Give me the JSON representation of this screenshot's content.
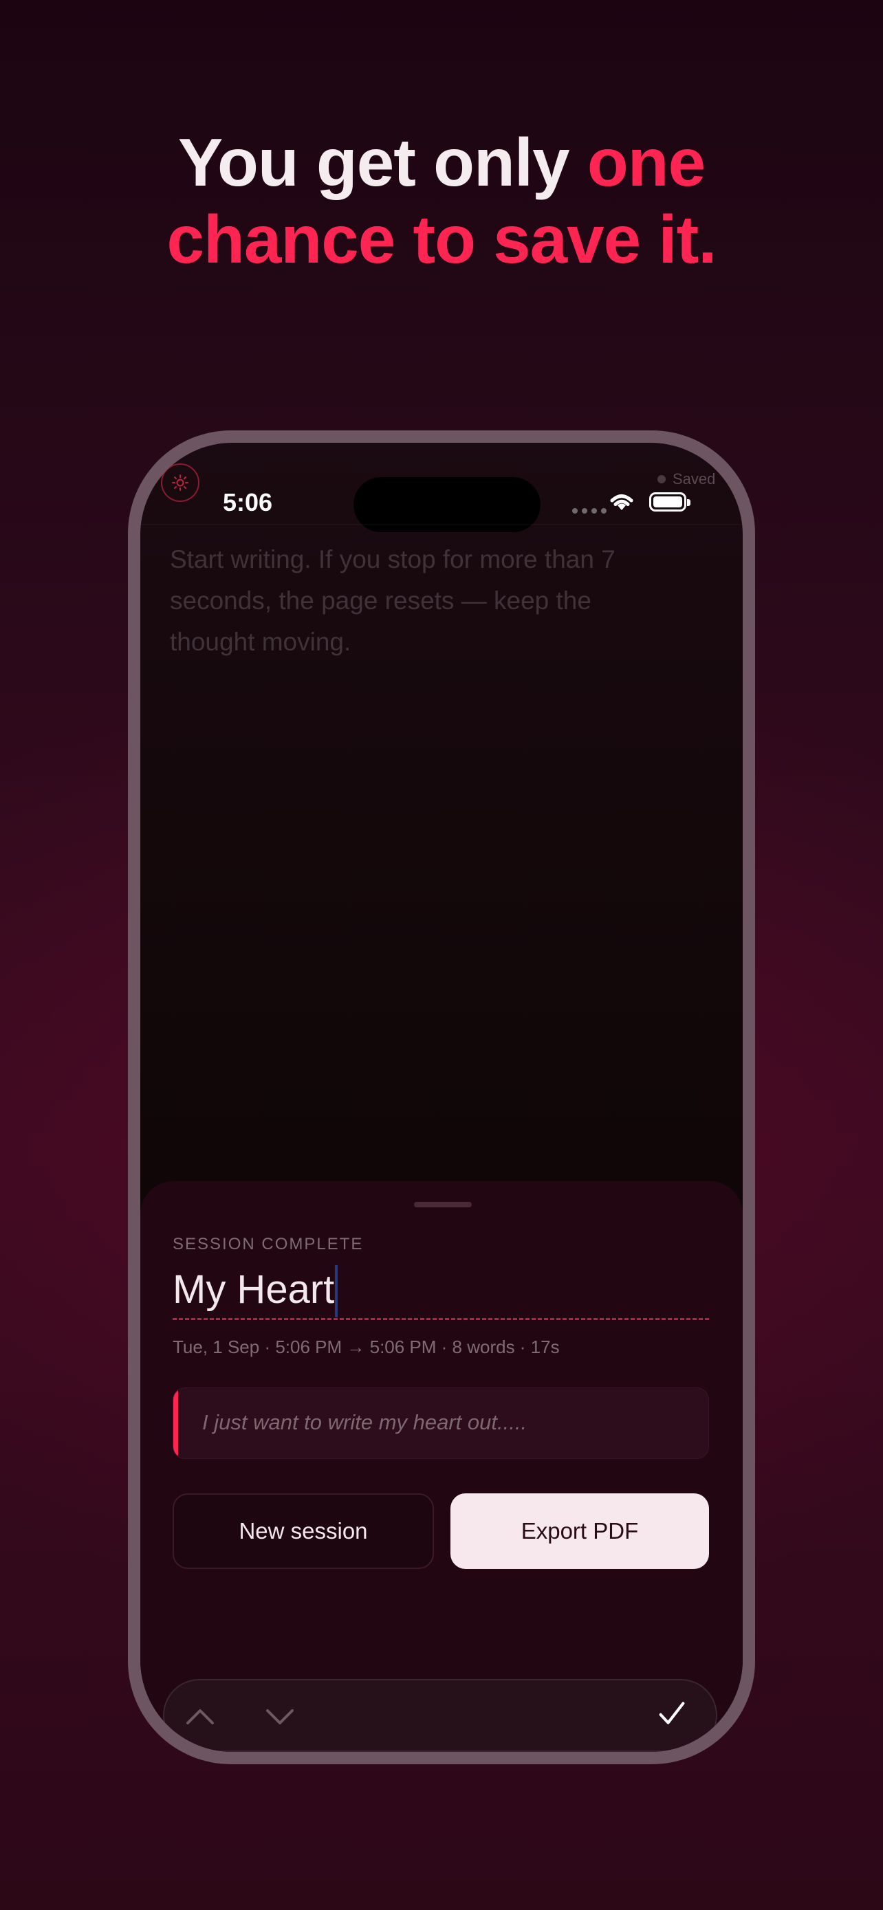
{
  "headline": {
    "line1_white": "You get only",
    "line1_red": "one",
    "line2_red": "chance to save it."
  },
  "status_bar": {
    "time": "5:06",
    "saved_label": "Saved"
  },
  "editor": {
    "prompt": "Start writing. If you stop for more than 7 seconds, the page resets — keep the thought moving."
  },
  "sheet": {
    "label": "SESSION COMPLETE",
    "title_value": "My Heart",
    "meta": "Tue, 1 Sep · 5:06 PM → 5:06 PM · 8 words · 17s",
    "excerpt": "I just want to write my heart out.....",
    "new_session_label": "New session",
    "export_label": "Export PDF"
  },
  "icons": {
    "settings": "sun-icon",
    "up": "chevron-up-icon",
    "down": "chevron-down-icon",
    "done": "checkmark-icon"
  },
  "colors": {
    "accent": "#ff2553",
    "background": "#2a0818",
    "sheet": "#220713",
    "button_light": "#f6e8ec"
  }
}
